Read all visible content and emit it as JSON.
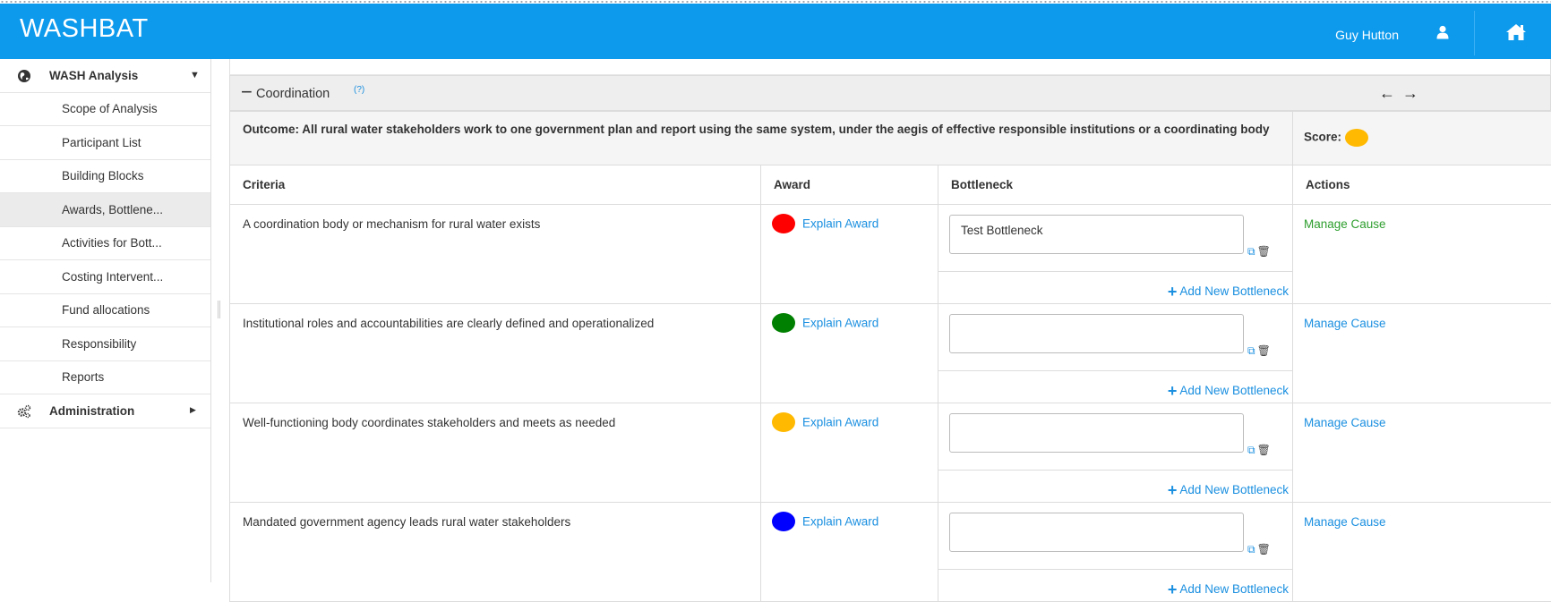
{
  "app": {
    "title": "WASHBAT",
    "user": "Guy Hutton"
  },
  "sidebar": {
    "section_main": "WASH Analysis",
    "items": [
      {
        "label": "Scope of Analysis"
      },
      {
        "label": "Participant List"
      },
      {
        "label": "Building Blocks"
      },
      {
        "label": "Awards, Bottlene..."
      },
      {
        "label": "Activities for Bott..."
      },
      {
        "label": "Costing Intervent..."
      },
      {
        "label": "Fund allocations"
      },
      {
        "label": "Responsibility"
      },
      {
        "label": "Reports"
      }
    ],
    "section_admin": "Administration"
  },
  "panel": {
    "title": "Coordination",
    "help": "(?)",
    "outcome": "Outcome: All rural water stakeholders work to one government plan and report using the same system, under the aegis of effective responsible institutions or a coordinating body",
    "score_label": "Score:",
    "score_color": "#ffb900"
  },
  "table": {
    "headers": {
      "criteria": "Criteria",
      "award": "Award",
      "bottleneck": "Bottleneck",
      "actions": "Actions"
    },
    "rows": [
      {
        "criteria": "A coordination body or mechanism for rural water exists",
        "award_color": "#ff0000",
        "award_link": "Explain Award",
        "bottleneck_value": "Test Bottleneck",
        "action": "Manage Cause",
        "add_new": "Add New Bottleneck"
      },
      {
        "criteria": "Institutional roles and accountabilities are clearly defined and operationalized",
        "award_color": "#008000",
        "award_link": "Explain Award",
        "bottleneck_value": "",
        "action": "Manage Cause",
        "add_new": "Add New Bottleneck"
      },
      {
        "criteria": "Well-functioning body coordinates stakeholders and meets as needed",
        "award_color": "#ffb900",
        "award_link": "Explain Award",
        "bottleneck_value": "",
        "action": "Manage Cause",
        "add_new": "Add New Bottleneck"
      },
      {
        "criteria": "Mandated government agency leads rural water stakeholders",
        "award_color": "#0000ff",
        "award_link": "Explain Award",
        "bottleneck_value": "",
        "action": "Manage Cause",
        "add_new": "Add New Bottleneck"
      }
    ]
  },
  "colors": {
    "accent": "#0d9aed",
    "link": "#1a8fe0",
    "manage_active": "#2e9e2e"
  }
}
